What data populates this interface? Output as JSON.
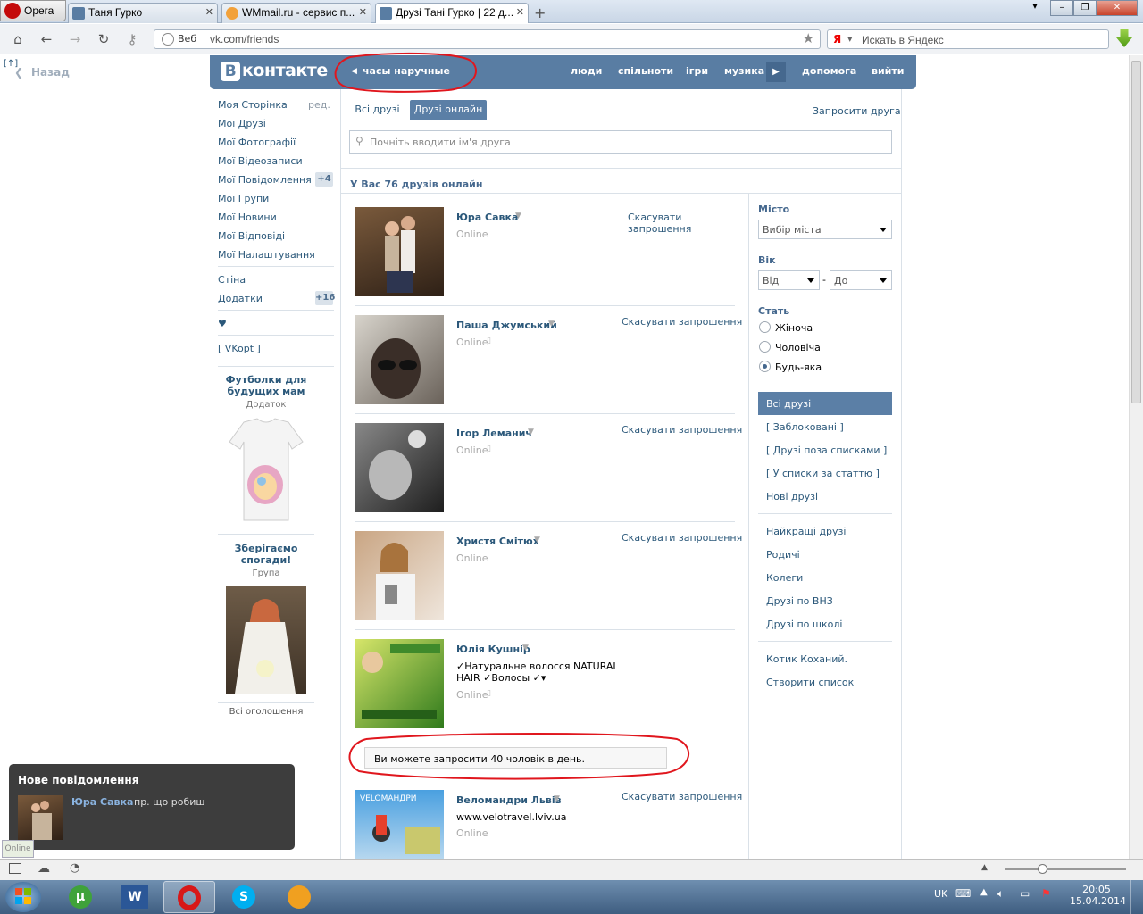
{
  "browser": {
    "menu_label": "Opera",
    "tabs": [
      {
        "label": "Таня Гурко",
        "favicon": "vk-icon"
      },
      {
        "label": "WMmail.ru - сервис п...",
        "favicon": "wmmail-icon"
      },
      {
        "label": "Друзі Тані Гурко | 22 д...",
        "favicon": "vk-icon",
        "active": true
      }
    ],
    "address_prefix": "Веб",
    "address": "vk.com/friends",
    "search_placeholder": "Искать в Яндекс"
  },
  "sidebar_back": {
    "label": "Назад"
  },
  "header": {
    "logo": "контакте",
    "logo_letter": "В",
    "status_text": "часы наручные",
    "nav": [
      "люди",
      "спільноти",
      "ігри",
      "музика",
      "допомога",
      "вийти"
    ]
  },
  "left_menu": {
    "items": [
      {
        "label": "Моя Сторінка",
        "extra": "ред."
      },
      {
        "label": "Мої Друзі"
      },
      {
        "label": "Мої Фотографії"
      },
      {
        "label": "Мої Відеозаписи"
      },
      {
        "label": "Мої Повідомлення",
        "badge": "+4"
      },
      {
        "label": "Мої Групи"
      },
      {
        "label": "Мої Новини"
      },
      {
        "label": "Мої Відповіді"
      },
      {
        "label": "Мої Налаштування"
      }
    ],
    "items2": [
      {
        "label": "Стіна"
      },
      {
        "label": "Додатки",
        "badge": "+16"
      }
    ],
    "heart": "♥",
    "vkopt": "[ VKopt ]"
  },
  "ads": [
    {
      "title": "Футболки для майбутніх мам",
      "title_line1": "Футболки для",
      "title_line2": "будущих мам",
      "type": "Додаток"
    },
    {
      "title_line1": "Зберігаємо",
      "title_line2": "спогади!",
      "type": "Група"
    }
  ],
  "ads_all": "Всі оголошення",
  "tabs": {
    "all": "Всі друзі",
    "online": "Друзі онлайн",
    "invite": "Запросити друга"
  },
  "search": {
    "placeholder": "Почніть вводити ім'я друга"
  },
  "summary": "У Вас 76 друзів онлайн",
  "friends": [
    {
      "name": "Юра Савка",
      "status": "Online",
      "action": "Скасувати запрошення",
      "action_l1": "Скасувати",
      "action_l2": "запрошення"
    },
    {
      "name": "Паша Джумський",
      "status": "Online",
      "action": "Скасувати запрошення"
    },
    {
      "name": "Ігор Леманич",
      "status": "Online",
      "action": "Скасувати запрошення"
    },
    {
      "name": "Христя Смітюх",
      "status": "Online",
      "action": "Скасувати запрошення"
    },
    {
      "name": "Юлія Кушнір",
      "status": "Online",
      "extra_l1": "✓Натуральне волосся NATURAL",
      "extra_l2": "HAIR ✓Волосы ✓▾"
    },
    {
      "name": "Веломандри Львів",
      "status": "Online",
      "action": "Скасувати запрошення",
      "extra": "www.velotravel.lviv.ua"
    }
  ],
  "invite_notice": "Ви можете запросити 40 чоловік в день.",
  "filters": {
    "city_label": "Місто",
    "city_value": "Вибір міста",
    "age_label": "Вік",
    "age_from": "Від",
    "age_sep": "-",
    "age_to": "До",
    "sex_label": "Стать",
    "sex_options": [
      "Жіноча",
      "Чоловіча",
      "Будь-яка"
    ],
    "lists": [
      "Всі друзі",
      "[ Заблоковані ]",
      "[ Друзі поза списками ]",
      "[ У списки за статтю ]",
      "Нові друзі"
    ],
    "lists2": [
      "Найкращі друзі",
      "Родичі",
      "Колеги",
      "Друзі по ВНЗ",
      "Друзі по школі"
    ],
    "lists3": [
      "Котик Коханий.",
      "Створити список"
    ]
  },
  "notification": {
    "title": "Нове повідомлення",
    "name": "Юра Савка",
    "text": "пр. що робиш",
    "tag": "Online"
  },
  "tray": {
    "lang": "UK",
    "time": "20:05",
    "date": "15.04.2014"
  },
  "colors": {
    "vk_blue": "#597da3",
    "link": "#2b587a",
    "annotation_red": "#e0161d"
  }
}
